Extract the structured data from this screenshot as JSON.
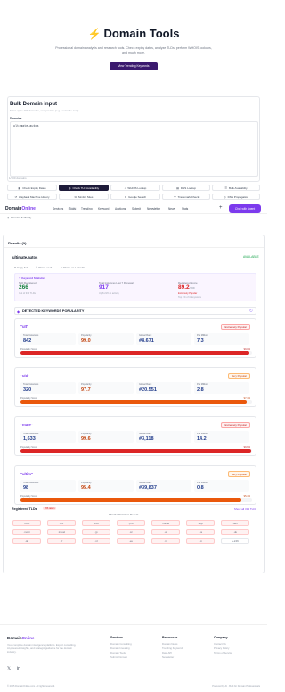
{
  "hero": {
    "title": "Domain Tools",
    "description": "Professional domain analysis and research tools. Check expiry dates, analyze TLDs, perform WHOIS lookups, and much more.",
    "cta": "View Trending Keywords"
  },
  "bulk": {
    "title": "Bulk Domain input",
    "subtitle": "Enter up to 100 domains, one per line (e.g., example.com)",
    "field_label": "Domains",
    "value": "ultimate.autos",
    "count": "1/100 domains"
  },
  "tools": [
    {
      "label": "Check Expiry Dates",
      "icon": "calendar-icon"
    },
    {
      "label": "Check TLD Availability",
      "icon": "globe-icon"
    },
    {
      "label": "WHOIS Lookup",
      "icon": "search-icon"
    },
    {
      "label": "DNS Lookup",
      "icon": "server-icon"
    },
    {
      "label": "Bulk Availability",
      "icon": "list-icon"
    },
    {
      "label": "Wayback Machine History",
      "icon": "history-icon"
    },
    {
      "label": "Similar Sites",
      "icon": "sites-icon"
    },
    {
      "label": "Google Search",
      "icon": "google-icon"
    },
    {
      "label": "Trademark Check",
      "icon": "trademark-icon"
    },
    {
      "label": "DNS Propagation",
      "icon": "propagation-icon"
    },
    {
      "label": "Domain Authority",
      "icon": "authority-icon"
    }
  ],
  "nav": {
    "logo_main": "Domain",
    "logo_accent": "Online",
    "items": [
      "Services",
      "Tools",
      "Trending",
      "Keyword",
      "Auctions",
      "Submit",
      "Newsletter",
      "News",
      "Stats"
    ],
    "chat": "Chat with Agent"
  },
  "results": {
    "title": "Results (1)",
    "domain": "ultimate.autos",
    "status": "AVAILABLE",
    "actions": [
      "Copy link",
      "Share on X",
      "Share on LinkedIn"
    ],
    "keyword_stats": {
      "heading": "Keyword Statistics",
      "tlds_label": "TLD Registered",
      "tlds_value": "266",
      "tlds_sub": "Out of 334 TLDs",
      "total_label": "Total Instances Last 7 Renewal",
      "total_value": "917",
      "total_sub": "Up 8.21% in activity",
      "reg_label": "Registered Score",
      "reg_value": "89.2",
      "reg_unit": "/100",
      "reg_tag": "Extremely Popular",
      "reg_sub": "Top 1% of in keywords"
    },
    "detected_title": "DETECTED KEYWORDS POPULARITY",
    "keywords": [
      {
        "term": "\"ult\"",
        "badge": "Extremely Popular",
        "instances": "842",
        "popularity": "99.0",
        "rank": "#8,671",
        "per_million": "7.3",
        "score": "99.0%",
        "fill": 0.99,
        "color": "#dc2626"
      },
      {
        "term": "\"ulti\"",
        "badge": "Very Popular",
        "instances": "320",
        "popularity": "97.7",
        "rank": "#20,551",
        "per_million": "2.8",
        "score": "97.7%",
        "fill": 0.977,
        "color": "#ea580c"
      },
      {
        "term": "\"mate\"",
        "badge": "Extremely Popular",
        "instances": "1,633",
        "popularity": "99.6",
        "rank": "#3,118",
        "per_million": "14.2",
        "score": "99.6%",
        "fill": 0.996,
        "color": "#dc2626"
      },
      {
        "term": "\"ultim\"",
        "badge": "Very Popular",
        "instances": "98",
        "popularity": "95.4",
        "rank": "#39,837",
        "per_million": "0.8",
        "score": "95.4%",
        "fill": 0.954,
        "color": "#ea580c"
      }
    ],
    "stat_labels": {
      "instances": "Total Instances",
      "popularity": "Popularity",
      "rank": "Global Rank",
      "per_million": "Per Million"
    },
    "score_label": "Popularity Score"
  },
  "tlds": {
    "title": "Registered TLDs",
    "badge": "266 taken",
    "view_all": "Show all 334 TLDs",
    "check_alt": "Check Alternative Sellers",
    "items": [
      ".com",
      ".biz",
      ".info",
      ".pro",
      ".name",
      ".app",
      ".dev",
      ".mobi",
      ".travel",
      ".jp",
      ".cc",
      ".us",
      ".ca",
      ".uk",
      ".de",
      ".fr",
      ".nl",
      ".eu",
      ".in",
      ".cn",
      ".+246"
    ]
  },
  "footer": {
    "logo_main": "Domain",
    "logo_accent": "Online",
    "desc": "Your complete domain intelligence platform. Expert consulting, AI-powered insights, and strategic guidance for the domain industry.",
    "col1_title": "Services",
    "col1": [
      "Domain Consulting",
      "Domain Investing",
      "Domain Tools",
      "Submit Domain"
    ],
    "col2_title": "Resources",
    "col2": [
      "Domain News",
      "Trending Keywords",
      "Data API",
      "Newsletter"
    ],
    "col3_title": "Company",
    "col3": [
      "Contact Us",
      "Privacy Policy",
      "Terms of Service"
    ],
    "copyright": "© 2025 DomainOnline.com. All rights reserved.",
    "powered": "Powered by AI · Built for Domain Professionals"
  }
}
